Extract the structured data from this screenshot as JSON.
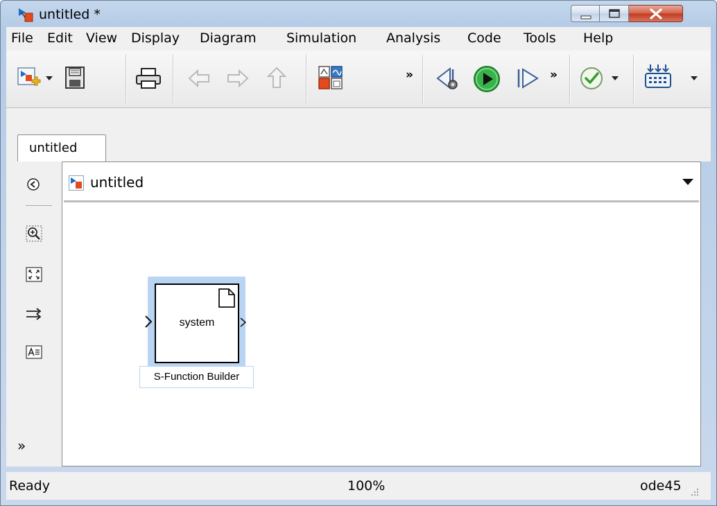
{
  "window": {
    "title": "untitled *",
    "app_icon": "simulink-model-icon",
    "buttons": [
      "minimize-icon",
      "maximize-icon",
      "close-icon"
    ]
  },
  "menu": {
    "items": [
      "File",
      "Edit",
      "View",
      "Display",
      "Diagram",
      "Simulation",
      "Analysis",
      "Code",
      "Tools",
      "Help"
    ]
  },
  "toolbar": {
    "more_glyph": "»",
    "icons": [
      "new-model-icon",
      "save-icon",
      "print-icon",
      "back-icon",
      "forward-icon",
      "up-icon",
      "library-browser-icon",
      "step-back-icon",
      "run-icon",
      "step-forward-icon",
      "model-advisor-icon",
      "build-icon"
    ]
  },
  "tab": {
    "label": "untitled"
  },
  "address": {
    "path": "untitled"
  },
  "palette": {
    "more_glyph": "»",
    "icons": [
      "hide-browser-icon",
      "zoom-icon",
      "fit-to-view-icon",
      "signal-routing-icon",
      "annotation-icon",
      "more-icon"
    ]
  },
  "block": {
    "body_text": "system",
    "name": "S-Function Builder"
  },
  "status": {
    "left": "Ready",
    "zoom": "100%",
    "solver": "ode45"
  },
  "colors": {
    "selection": "#bad4f4",
    "run_button": "#36b34a",
    "frame": "#b4cbe6",
    "close_button": "#c13c22"
  }
}
